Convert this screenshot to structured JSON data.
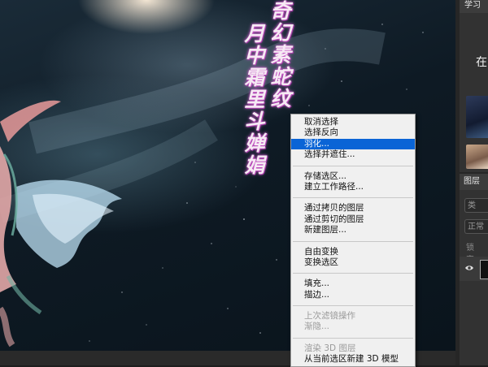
{
  "canvas": {
    "calligraphy": {
      "column_right": "奇幻素蛇纹",
      "column_left": "月中霜里斗婵娟"
    }
  },
  "right_panel": {
    "learn_tab": "学习",
    "learn_heading": "在",
    "layers_tab": "图层",
    "search_placeholder": "类",
    "blend_mode": "正常",
    "lock_label": "锁定："
  },
  "context_menu": {
    "groups": [
      [
        {
          "label": "取消选择",
          "enabled": true,
          "highlighted": false
        },
        {
          "label": "选择反向",
          "enabled": true,
          "highlighted": false
        },
        {
          "label": "羽化...",
          "enabled": true,
          "highlighted": true
        },
        {
          "label": "选择并遮住...",
          "enabled": true,
          "highlighted": false
        }
      ],
      [
        {
          "label": "存储选区...",
          "enabled": true,
          "highlighted": false
        },
        {
          "label": "建立工作路径...",
          "enabled": true,
          "highlighted": false
        }
      ],
      [
        {
          "label": "通过拷贝的图层",
          "enabled": true,
          "highlighted": false
        },
        {
          "label": "通过剪切的图层",
          "enabled": true,
          "highlighted": false
        },
        {
          "label": "新建图层...",
          "enabled": true,
          "highlighted": false
        }
      ],
      [
        {
          "label": "自由变换",
          "enabled": true,
          "highlighted": false
        },
        {
          "label": "变换选区",
          "enabled": true,
          "highlighted": false
        }
      ],
      [
        {
          "label": "填充...",
          "enabled": true,
          "highlighted": false
        },
        {
          "label": "描边...",
          "enabled": true,
          "highlighted": false
        }
      ],
      [
        {
          "label": "上次滤镜操作",
          "enabled": false,
          "highlighted": false
        },
        {
          "label": "渐隐...",
          "enabled": false,
          "highlighted": false
        }
      ],
      [
        {
          "label": "渲染 3D 图层",
          "enabled": false,
          "highlighted": false
        },
        {
          "label": "从当前选区新建 3D 模型",
          "enabled": true,
          "highlighted": false
        }
      ]
    ]
  },
  "colors": {
    "menu_highlight": "#0a64d6",
    "menu_background": "#f0f0f0",
    "panel_background": "#323232"
  }
}
